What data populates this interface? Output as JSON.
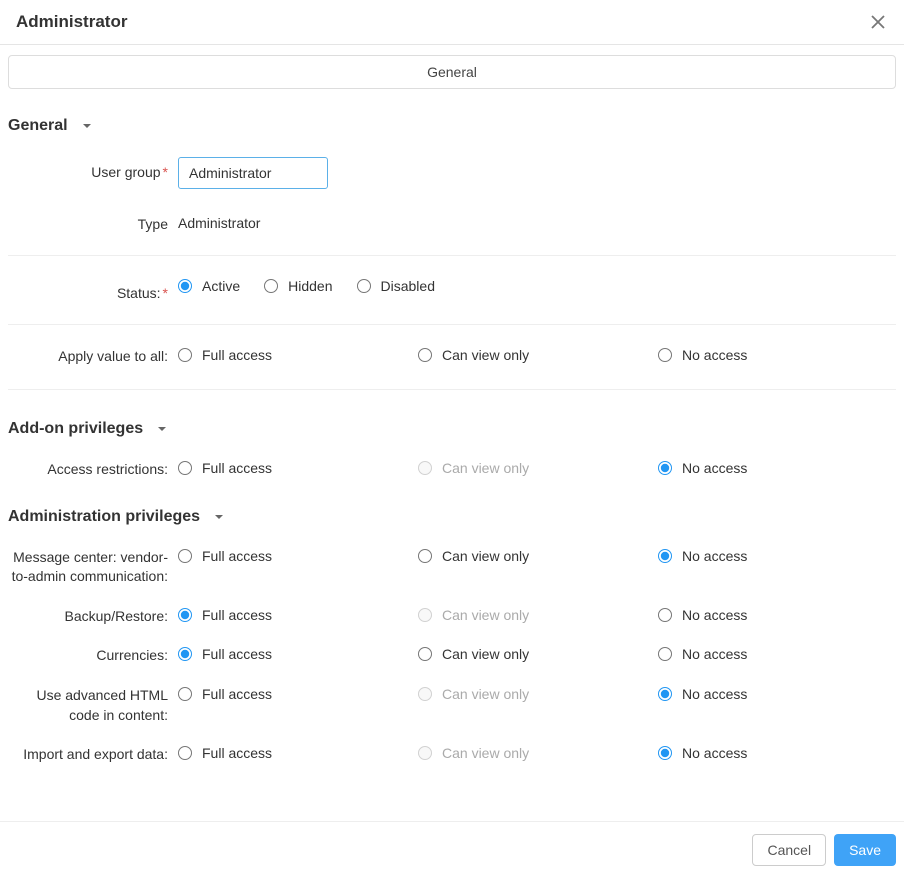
{
  "title": "Administrator",
  "tab_general": "General",
  "section_general": "General",
  "labels": {
    "user_group": "User group",
    "type": "Type",
    "status": "Status:",
    "apply_all": "Apply value to all:"
  },
  "user_group_value": "Administrator",
  "type_value": "Administrator",
  "status": {
    "active": "Active",
    "hidden": "Hidden",
    "disabled": "Disabled",
    "selected": "active"
  },
  "access_labels": {
    "full": "Full access",
    "view": "Can view only",
    "none": "No access"
  },
  "section_addon": "Add-on privileges",
  "addon_rows": {
    "access_restrictions": {
      "label": "Access restrictions:",
      "selected": "none",
      "view_disabled": true
    }
  },
  "section_admin": "Administration privileges",
  "admin_rows": {
    "msg_center": {
      "label": "Message center: vendor-to-admin communication:",
      "selected": "none",
      "view_disabled": false
    },
    "backup": {
      "label": "Backup/Restore:",
      "selected": "full",
      "view_disabled": true
    },
    "currencies": {
      "label": "Currencies:",
      "selected": "full",
      "view_disabled": false
    },
    "html": {
      "label": "Use advanced HTML code in content:",
      "selected": "none",
      "view_disabled": true
    },
    "import_export": {
      "label": "Import and export data:",
      "selected": "none",
      "view_disabled": true
    }
  },
  "buttons": {
    "cancel": "Cancel",
    "save": "Save"
  }
}
